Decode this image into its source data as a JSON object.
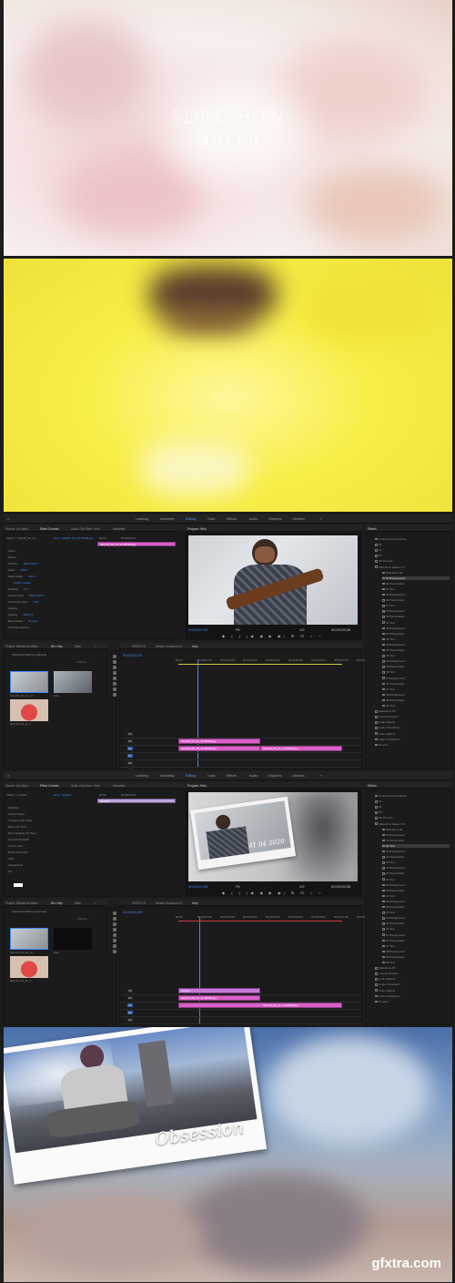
{
  "panel1": {
    "title_line1": "SLIDESHOW",
    "title_line2": "MAKER"
  },
  "editor1": {
    "menu": [
      "Learning",
      "Assembly",
      "Editing",
      "Color",
      "Effects",
      "Audio",
      "Graphics",
      "Libraries",
      "»"
    ],
    "active_menu": "Editing",
    "source_tabs": [
      "Source: (no clips)",
      "Effect Controls",
      "Audio Clip Mixer: Help",
      "Metadata"
    ],
    "program_title": "Program: Help",
    "ec_master": "Master * help.00_00_12...",
    "ec_seq": "Help * help/00_00_12.00000.jpg",
    "ec_timecode_start": "00:00",
    "ec_timecode_end": "00;00;04;00",
    "ec_clip": "help.00_00_12_12.00000.jpg",
    "ec_rows": [
      {
        "label": "Video",
        "value": ""
      },
      {
        "label": "Motion",
        "value": ""
      },
      {
        "label": "Position",
        "value": "960.0   540.0"
      },
      {
        "label": "Scale",
        "value": "100.0"
      },
      {
        "label": "Scale Width",
        "value": "100.0"
      },
      {
        "label": "",
        "value": "Uniform Scale"
      },
      {
        "label": "Rotation",
        "value": "0.0"
      },
      {
        "label": "Anchor Point",
        "value": "960.0   540.0"
      },
      {
        "label": "Anti-flicker Filter",
        "value": "0.00"
      },
      {
        "label": "Opacity",
        "value": ""
      },
      {
        "label": "Opacity",
        "value": "100.0 %"
      },
      {
        "label": "Blend Mode",
        "value": "Normal"
      },
      {
        "label": "Time Remapping",
        "value": ""
      }
    ],
    "program_tc_left": "00;00;01;00",
    "program_fit": "Fit",
    "program_ratio": "1/2",
    "program_tc_right": "00;00;09;28",
    "project_tabs": [
      "Project: Slideshow Maker",
      "Bin: Help",
      "Medi",
      "»"
    ],
    "project_file": "Slideshow Maker.prproj/Help",
    "project_count": "2 of 3 it...",
    "thumbs": [
      "help.00_00_12_12...",
      "help",
      "help.00_00_11_1..."
    ],
    "timeline_tabs": [
      "PHOTO 01",
      "Nested Sequence 01",
      "Help"
    ],
    "timeline_tc": "00;00;01;00",
    "ruler": [
      ":00:00",
      "00;00;01;00",
      "00;00;02;00",
      "00;00;03;00",
      "00;00;04;00",
      "00;00;05;00",
      "00;00;06;00",
      "00;00;07;00",
      "00;00;08;00"
    ],
    "track_labels": [
      "V3",
      "V2",
      "V1",
      "A1",
      "A2",
      "A3"
    ],
    "clips": [
      "help.00_00_11_11.00000.jpg",
      "help.00_00_12_12.00000.jpg",
      "help.00_00_11_13.00000.jpg"
    ],
    "effects_title": "Effects",
    "effects_items": [
      "Customise new Quote",
      "01",
      "02",
      "03",
      "Mir Presets",
      "Slideshow Maker 3.5",
      "Slideshow 02",
      "01 Background",
      "01 Placeholder",
      "01 Text",
      "02 Background",
      "02 Placeholder",
      "02 Text",
      "03 Background",
      "03 Placeholder",
      "03 Text",
      "04 Background",
      "04 Placeholder",
      "04 Text",
      "05 Background",
      "05 Placeholder",
      "05 Text",
      "06 Background",
      "06 Placeholder",
      "06 Text",
      "07 Background",
      "07 Placeholder",
      "07 Text",
      "08 Background",
      "08 Placeholder",
      "08 Text",
      "Slideshow 03",
      "Lumetri Presets",
      "Audio Effects",
      "Audio Transitions",
      "Video Effects",
      "Video Transitions",
      "Presets"
    ]
  },
  "editor2": {
    "ec_master": "Master * Graphic",
    "ec_seq": "Help * Graphic",
    "ec_timecode_start": "00:00",
    "ec_timecode_end": "00;00;04;00",
    "ec_clip": "Graphic",
    "ec_rows": [
      {
        "label": "Graphics",
        "value": ""
      },
      {
        "label": "Vector Motion",
        "value": ""
      },
      {
        "label": "Transform (01 Text)",
        "value": ""
      },
      {
        "label": "Basic (01 Text)",
        "value": ""
      },
      {
        "label": "Drop Shadow (01 Text)",
        "value": ""
      },
      {
        "label": "Text (01.04.2020)",
        "value": ""
      },
      {
        "label": "Source Text",
        "value": ""
      },
      {
        "label": "Brush Script MT",
        "value": ""
      },
      {
        "label": "Italic",
        "value": ""
      },
      {
        "label": "Appearance",
        "value": ""
      },
      {
        "label": "Fill",
        "value": ""
      }
    ],
    "preview_date": "01 04 2020",
    "program_tc_left": "00;00;01;09",
    "program_fit": "Fit",
    "program_ratio": "1/2",
    "program_tc_right": "00;00;09;28",
    "project_count": "2 of 3 it...",
    "thumbs": [
      "help.00_00_12_12...",
      "help",
      "help.00_00_11_1..."
    ],
    "timeline_tc": "00;00;01;09",
    "clips": [
      "Graphic",
      "help.00_00_12_12.00000.jpg",
      "help.00_00_11_13.00000.jpg"
    ]
  },
  "panel5": {
    "caption": "Obsession",
    "watermark": "gfxtra.com"
  }
}
